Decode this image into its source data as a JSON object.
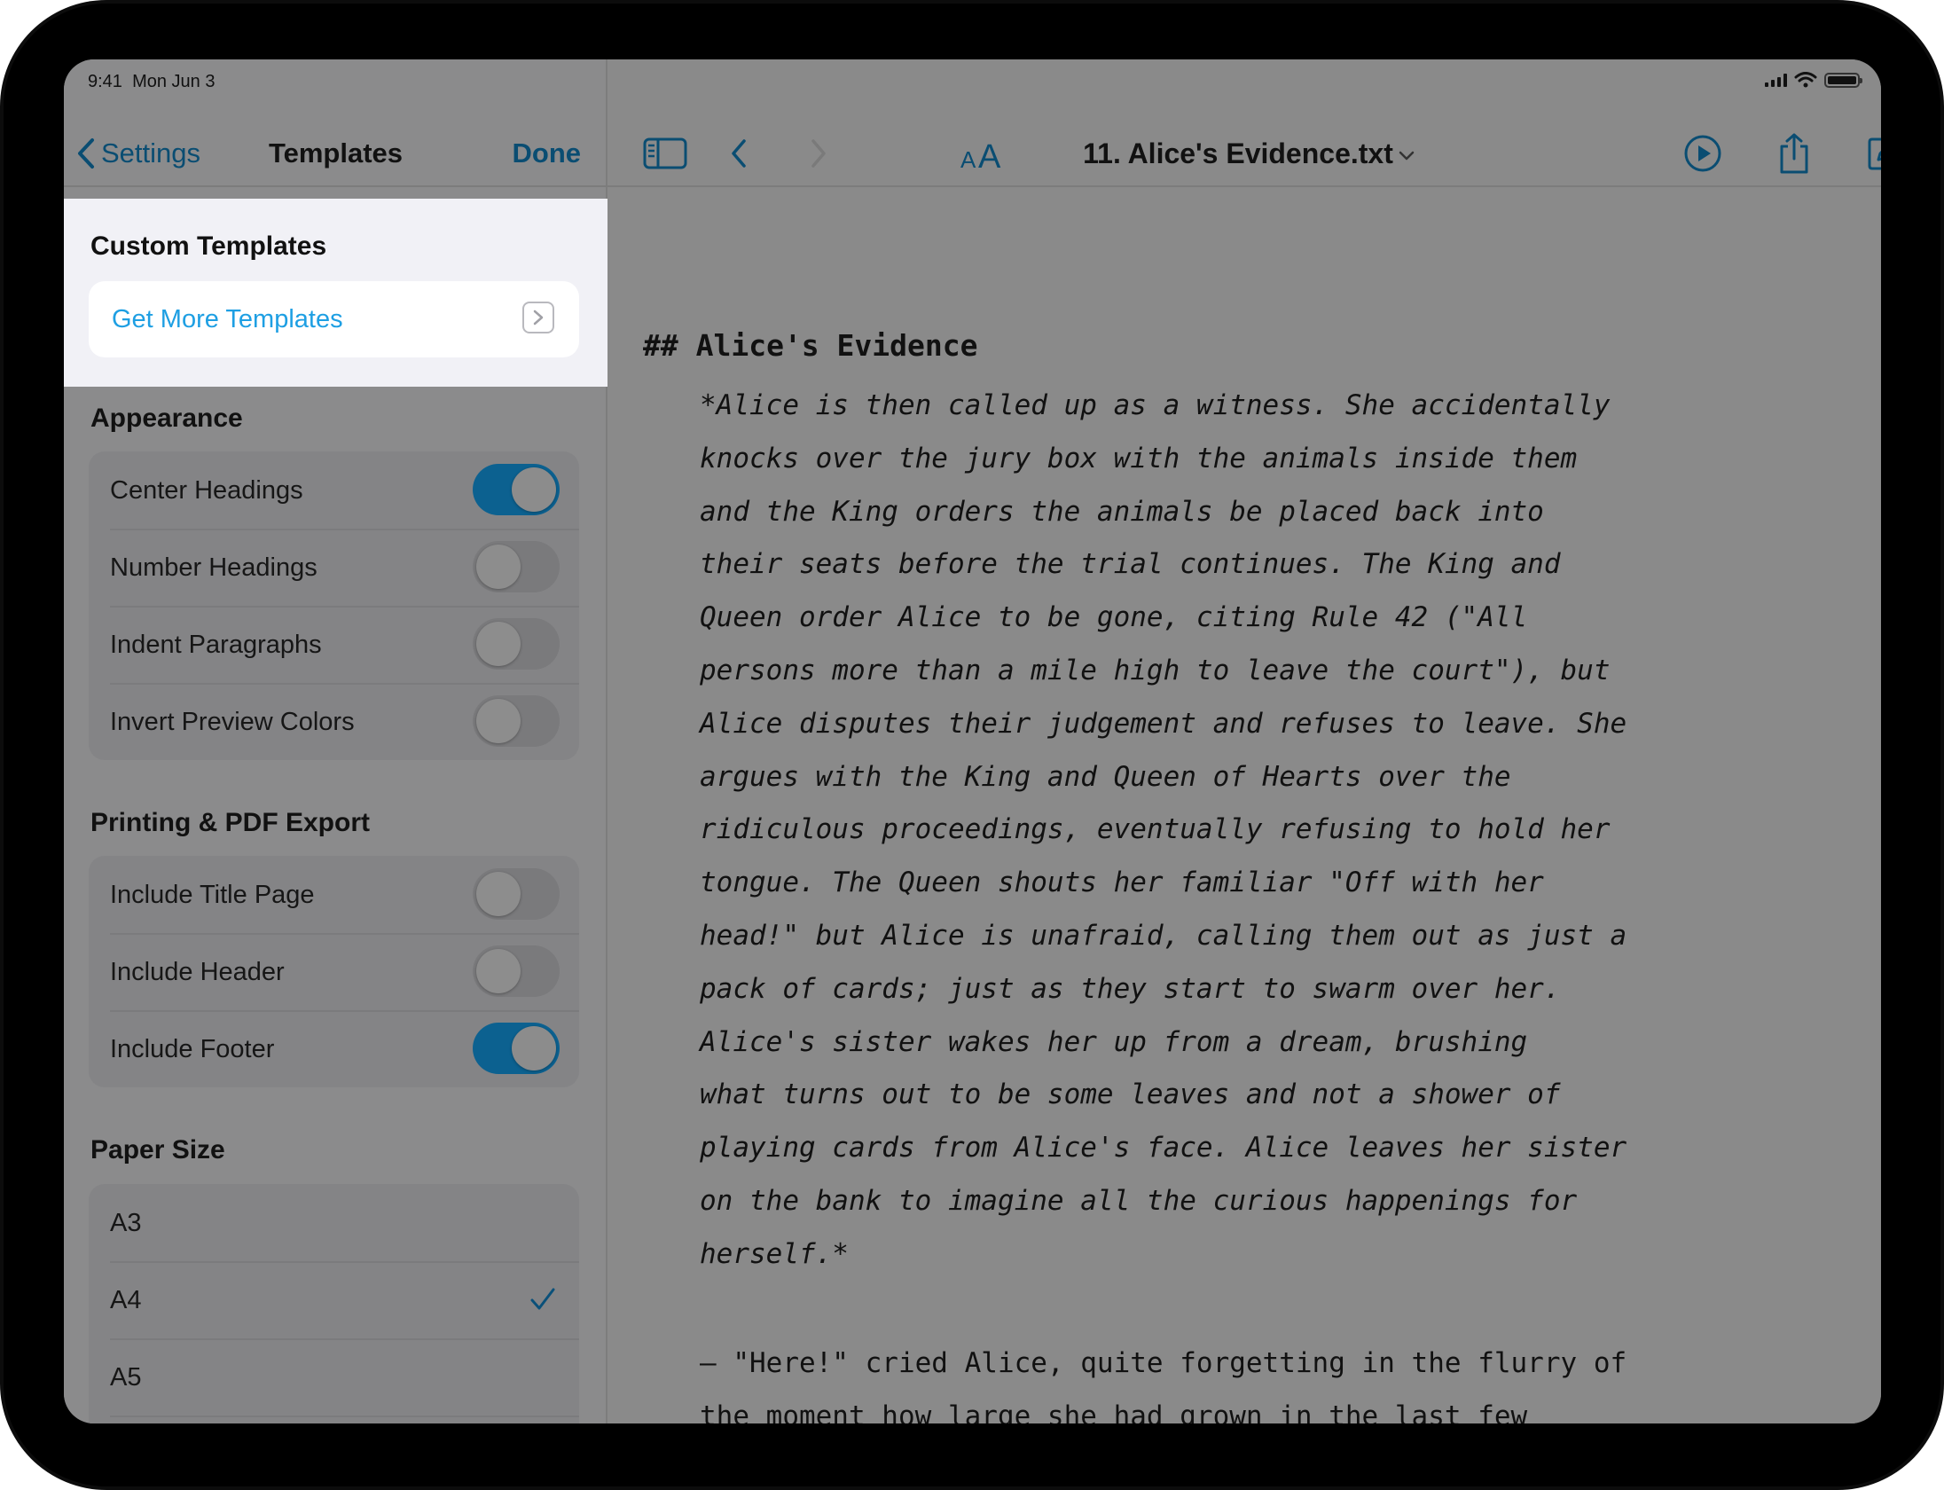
{
  "status_bar": {
    "time": "9:41",
    "date": "Mon Jun 3"
  },
  "sidebar": {
    "back_label": "Settings",
    "title": "Templates",
    "done_label": "Done",
    "custom_templates": {
      "header": "Custom Templates",
      "get_more": "Get More Templates"
    },
    "appearance": {
      "header": "Appearance",
      "items": [
        {
          "label": "Center Headings",
          "on": true
        },
        {
          "label": "Number Headings",
          "on": false
        },
        {
          "label": "Indent Paragraphs",
          "on": false
        },
        {
          "label": "Invert Preview Colors",
          "on": false
        }
      ]
    },
    "printing": {
      "header": "Printing & PDF Export",
      "items": [
        {
          "label": "Include Title Page",
          "on": false
        },
        {
          "label": "Include Header",
          "on": false
        },
        {
          "label": "Include Footer",
          "on": true
        }
      ]
    },
    "paper_size": {
      "header": "Paper Size",
      "items": [
        {
          "label": "A3",
          "selected": false
        },
        {
          "label": "A4",
          "selected": true
        },
        {
          "label": "A5",
          "selected": false
        }
      ]
    }
  },
  "toolbar": {
    "doc_title": "11. Alice's Evidence.txt",
    "icons": [
      "sidebar-icon",
      "back-chevron-icon",
      "forward-chevron-icon",
      "text-size-icon",
      "play-icon",
      "share-icon",
      "compose-icon"
    ]
  },
  "document": {
    "heading": "## Alice's Evidence",
    "paragraph_lines": [
      "*Alice is then called up as a witness. She accidentally",
      "knocks over the jury box with the animals inside them",
      "and the King orders the animals be placed back into",
      "their seats before the trial continues. The King and",
      "Queen order Alice to be gone, citing Rule 42 (\"All",
      "persons more than a mile high to leave the court\"), but",
      "Alice disputes their judgement and refuses to leave. She",
      "argues with the King and Queen of Hearts over the",
      "ridiculous proceedings, eventually refusing to hold her",
      "tongue. The Queen shouts her familiar \"Off with her",
      "head!\" but Alice is unafraid, calling them out as just a",
      "pack of cards; just as they start to swarm over her.",
      "Alice's sister wakes her up from a dream, brushing",
      "what turns out to be some leaves and not a shower of",
      "playing cards from Alice's face. Alice leaves her sister",
      "on the bank to imagine all the curious happenings for",
      "herself.*"
    ],
    "paragraph2_lines": [
      "— \"Here!\" cried Alice, quite forgetting in the flurry of",
      "the moment how large she had grown in the last few"
    ]
  },
  "colors": {
    "accent": "#0a4d72",
    "link": "#1e9fe3",
    "toggle_on": "#0c6190"
  }
}
